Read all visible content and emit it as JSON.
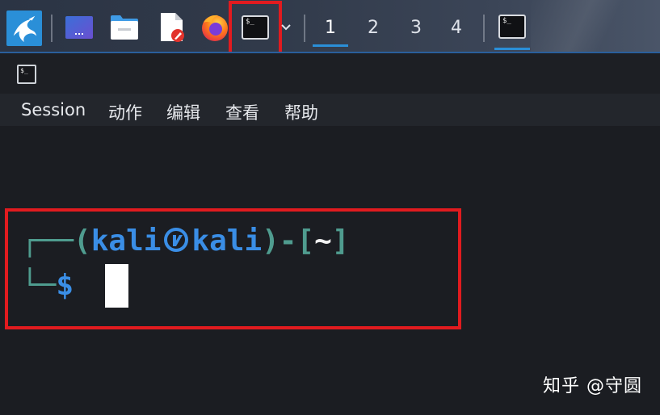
{
  "taskbar": {
    "workspaces": [
      "1",
      "2",
      "3",
      "4"
    ],
    "active_workspace": "1",
    "terminal_icon_text": "$_",
    "icons": [
      "kali-dragon-icon",
      "desktop-icon",
      "file-manager-icon",
      "text-editor-icon",
      "firefox-icon",
      "terminal-icon",
      "chevron-down-icon",
      "terminal-icon"
    ]
  },
  "window": {
    "icon_text": "$_",
    "menu": [
      "Session",
      "动作",
      "编辑",
      "查看",
      "帮助"
    ]
  },
  "terminal": {
    "line1_corner": "┌──",
    "line1_open": "(",
    "user": "kali",
    "host": "kali",
    "line1_mid": ")-[",
    "cwd": "~",
    "line1_close": "]",
    "line2_corner": "└─",
    "dollar": "$"
  },
  "watermark": "知乎 @守圆",
  "colors": {
    "accent": "#2a8fd8",
    "highlight": "#e11b1f",
    "prompt_green": "#4f9c8f",
    "prompt_blue": "#3a8ee6"
  }
}
